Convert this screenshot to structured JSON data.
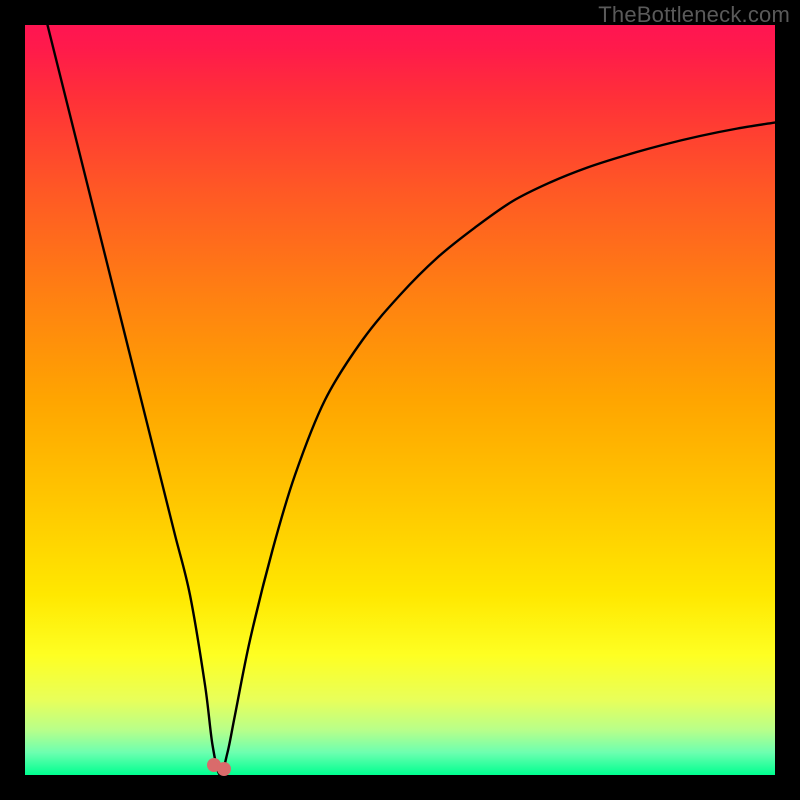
{
  "watermark": "TheBottleneck.com",
  "chart_data": {
    "type": "line",
    "title": "",
    "xlabel": "",
    "ylabel": "",
    "xlim": [
      0,
      100
    ],
    "ylim": [
      0,
      100
    ],
    "grid": false,
    "legend": false,
    "series": [
      {
        "name": "bottleneck-curve",
        "x": [
          3,
          5,
          8,
          10,
          12,
          15,
          18,
          20,
          22,
          24,
          25,
          26,
          27,
          28,
          30,
          33,
          36,
          40,
          45,
          50,
          55,
          60,
          65,
          70,
          75,
          80,
          85,
          90,
          95,
          100
        ],
        "y": [
          100,
          92,
          80,
          72,
          64,
          52,
          40,
          32,
          24,
          12,
          4,
          0,
          3,
          8,
          18,
          30,
          40,
          50,
          58,
          64,
          69,
          73,
          76.5,
          79,
          81,
          82.6,
          84,
          85.2,
          86.2,
          87
        ]
      }
    ],
    "markers": [
      {
        "name": "optimal-point-a",
        "x": 25.2,
        "y": 1.3,
        "color": "#d96b6b",
        "size": 14
      },
      {
        "name": "optimal-point-b",
        "x": 26.5,
        "y": 0.8,
        "color": "#d96b6b",
        "size": 14
      }
    ],
    "background_gradient": {
      "top": "#ff1552",
      "mid": "#ffa500",
      "low": "#feff22",
      "bottom": "#00ff90"
    }
  }
}
